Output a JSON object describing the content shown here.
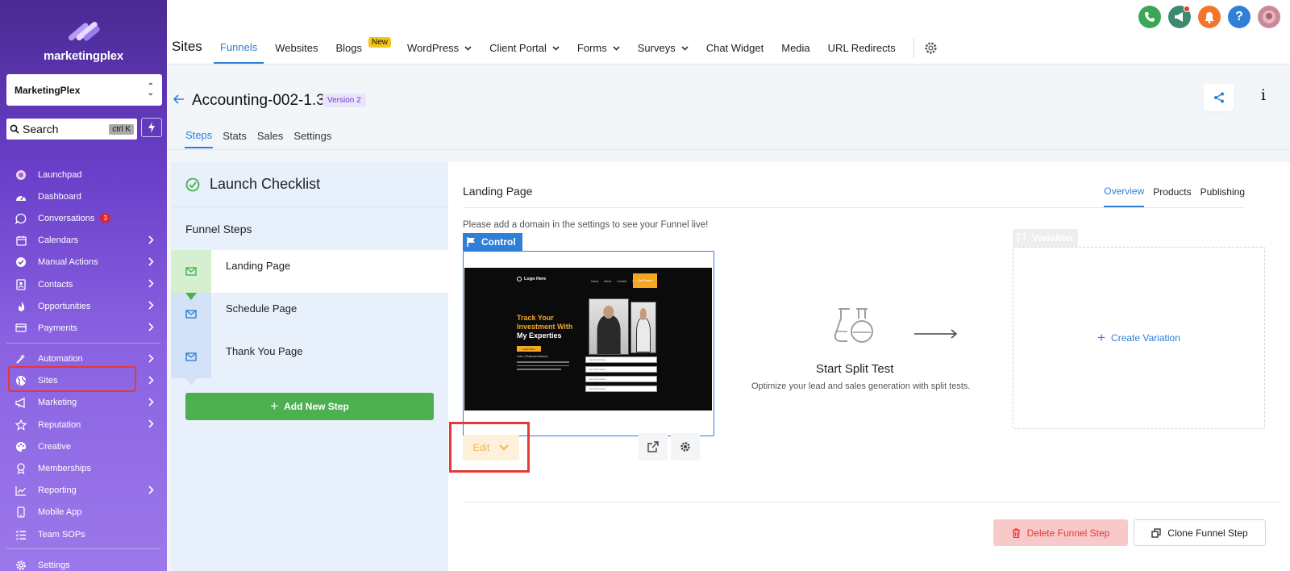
{
  "brand": {
    "name": "marketingplex"
  },
  "sidebar": {
    "account": "MarketingPlex",
    "search_placeholder": "Search",
    "search_shortcut": "ctrl K",
    "items": [
      {
        "label": "Launchpad",
        "icon": "launchpad-icon"
      },
      {
        "label": "Dashboard",
        "icon": "dashboard-icon"
      },
      {
        "label": "Conversations",
        "icon": "chat-icon",
        "badge": "3"
      },
      {
        "label": "Calendars",
        "icon": "calendar-icon",
        "chevron": true
      },
      {
        "label": "Manual Actions",
        "icon": "check-circle-icon",
        "chevron": true
      },
      {
        "label": "Contacts",
        "icon": "contacts-icon",
        "chevron": true
      },
      {
        "label": "Opportunities",
        "icon": "flame-icon",
        "chevron": true
      },
      {
        "label": "Payments",
        "icon": "card-icon",
        "chevron": true
      },
      {
        "label": "Automation",
        "icon": "automation-icon",
        "chevron": true
      },
      {
        "label": "Sites",
        "icon": "globe-icon",
        "chevron": true
      },
      {
        "label": "Marketing",
        "icon": "marketing-icon",
        "chevron": true
      },
      {
        "label": "Reputation",
        "icon": "star-icon",
        "chevron": true
      },
      {
        "label": "Creative",
        "icon": "palette-icon"
      },
      {
        "label": "Memberships",
        "icon": "membership-icon"
      },
      {
        "label": "Reporting",
        "icon": "chart-icon",
        "chevron": true
      },
      {
        "label": "Mobile App",
        "icon": "mobile-icon"
      },
      {
        "label": "Team SOPs",
        "icon": "list-icon"
      },
      {
        "label": "Settings",
        "icon": "gear-icon"
      }
    ]
  },
  "topbar": {
    "section_title": "Sites",
    "tabs": [
      {
        "label": "Funnels",
        "active": true
      },
      {
        "label": "Websites"
      },
      {
        "label": "Blogs",
        "tag": "New"
      },
      {
        "label": "WordPress",
        "dropdown": true
      },
      {
        "label": "Client Portal",
        "dropdown": true
      },
      {
        "label": "Forms",
        "dropdown": true
      },
      {
        "label": "Surveys",
        "dropdown": true
      },
      {
        "label": "Chat Widget"
      },
      {
        "label": "Media"
      },
      {
        "label": "URL Redirects"
      }
    ]
  },
  "funnel": {
    "title": "Accounting-002-1.3",
    "version": "Version 2",
    "subtabs": [
      "Steps",
      "Stats",
      "Sales",
      "Settings"
    ]
  },
  "steps_panel": {
    "checklist_title": "Launch Checklist",
    "section_label": "Funnel Steps",
    "steps": [
      "Landing Page",
      "Schedule Page",
      "Thank You Page"
    ],
    "add_button": "Add New Step"
  },
  "main": {
    "page_title": "Landing Page",
    "tabs": [
      "Overview",
      "Products",
      "Publishing"
    ],
    "domain_message": "Please add a domain in the settings to see your Funnel live!",
    "control_label": "Control",
    "edit_label": "Edit",
    "preview": {
      "logo": "Logo Here",
      "nav": "Home  About  Contact Us",
      "cta": "Get Started",
      "headline_1": "Track Your",
      "headline_2": "Investment With",
      "headline_3": "My Experties",
      "button": "Learn More",
      "name_line": "John. (Financial Advisor)",
      "field": "Your First Name"
    },
    "split_test": {
      "title": "Start Split Test",
      "subtitle": "Optimize your lead and sales generation with split tests."
    },
    "variation_label": "Variation",
    "create_variation": "Create Variation",
    "delete_button": "Delete Funnel Step",
    "clone_button": "Clone Funnel Step"
  },
  "colors": {
    "accent": "#2f7fd8",
    "success": "#4caf50",
    "danger": "#e53935",
    "sidebar_top": "#4a2a93",
    "sidebar_bottom": "#9c78ea"
  }
}
